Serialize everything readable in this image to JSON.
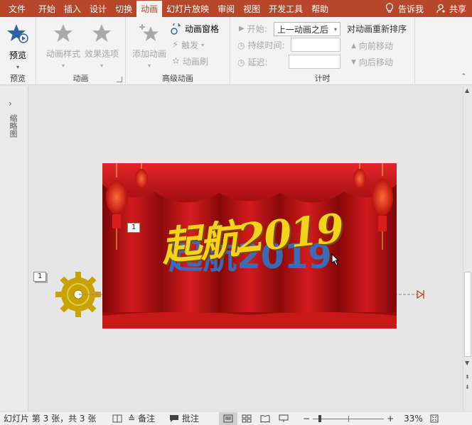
{
  "tabs": [
    {
      "label": "文件",
      "active": false
    },
    {
      "label": "开始",
      "active": false
    },
    {
      "label": "插入",
      "active": false
    },
    {
      "label": "设计",
      "active": false
    },
    {
      "label": "切换",
      "active": false
    },
    {
      "label": "动画",
      "active": true
    },
    {
      "label": "幻灯片放映",
      "active": false
    },
    {
      "label": "审阅",
      "active": false
    },
    {
      "label": "视图",
      "active": false
    },
    {
      "label": "开发工具",
      "active": false
    },
    {
      "label": "帮助",
      "active": false
    }
  ],
  "tell_me": "告诉我",
  "share": "共享",
  "ribbon": {
    "preview": {
      "button": "预览",
      "group": "预览"
    },
    "animation": {
      "style": "动画样式",
      "options": "效果选项",
      "group": "动画"
    },
    "advanced": {
      "add": "添加动画",
      "pane": "动画窗格",
      "trigger": "触发",
      "painter": "动画刷",
      "group": "高级动画"
    },
    "timing": {
      "start_label": "开始:",
      "start_value": "上一动画之后",
      "duration_label": "持续时间:",
      "delay_label": "延迟:",
      "reorder": "对动画重新排序",
      "forward": "向前移动",
      "backward": "向后移动",
      "group": "计时"
    }
  },
  "thumbnails_label": "缩略图",
  "slide": {
    "title_text": "起航2019",
    "tag_slide": "1",
    "tag_outside": "1"
  },
  "status": {
    "slide_info": "幻灯片 第 3 张，共 3 张",
    "notes": "备注",
    "comments": "批注",
    "zoom": "33%"
  },
  "colors": {
    "accent": "#b7472a",
    "curtain": "#c8141c",
    "gear": "#c9a203",
    "title": "#f5d31a"
  }
}
